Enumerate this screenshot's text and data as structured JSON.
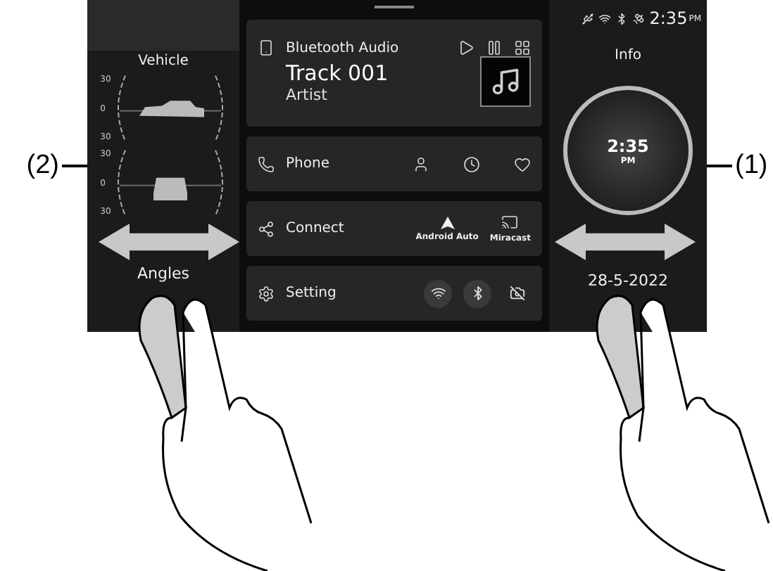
{
  "callouts": [
    {
      "label": "(2)"
    },
    {
      "label": "(1)"
    }
  ],
  "vehicle": {
    "title": "Vehicle",
    "gauges": [
      {
        "kind": "side",
        "ticks": [
          "30",
          "0",
          "30"
        ]
      },
      {
        "kind": "front",
        "ticks": [
          "30",
          "0",
          "30"
        ]
      }
    ],
    "footer": "Angles"
  },
  "media": {
    "title": "Bluetooth Audio",
    "track": "Track 001",
    "artist": "Artist"
  },
  "rows": [
    {
      "kind": "phone",
      "label": "Phone"
    },
    {
      "kind": "connect",
      "label": "Connect",
      "apps": [
        "Android Auto",
        "Miracast"
      ]
    },
    {
      "kind": "setting",
      "label": "Setting",
      "toggles": [
        {
          "kind": "wifi",
          "on": true
        },
        {
          "kind": "bluetooth",
          "on": true
        },
        {
          "kind": "camera",
          "on": false
        }
      ]
    }
  ],
  "status": {
    "time": "2:35",
    "meridiem": "PM"
  },
  "info": {
    "title": "Info",
    "clockTime": "2:35",
    "clockMeridiem": "PM",
    "date": "28-5-2022"
  }
}
